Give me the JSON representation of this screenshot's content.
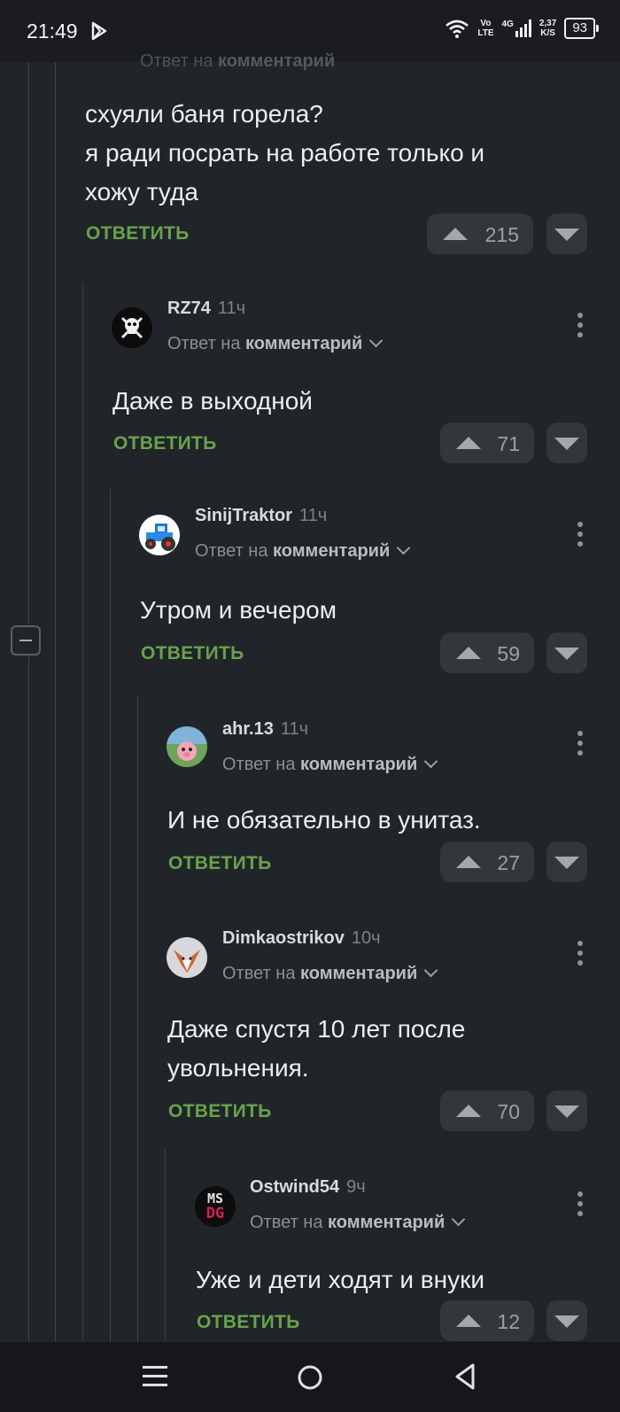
{
  "status_bar": {
    "time": "21:49",
    "net_top": "Vo",
    "net_bottom": "LTE",
    "signal": "4G",
    "speed_top": "2,37",
    "speed_bottom": "K/S",
    "battery": "93",
    "icons": [
      "play-store-icon",
      "wifi-icon",
      "signal-icon",
      "battery-icon"
    ]
  },
  "thread": {
    "cut_header": {
      "prefix": "Ответ на",
      "target": "комментарий"
    },
    "top_comment": {
      "lines": [
        "схуяли баня горела?",
        "я ради посрать на работе только и",
        "хожу туда"
      ],
      "reply_label": "ОТВЕТИТЬ",
      "votes": "215"
    },
    "comments": [
      {
        "author": "RZ74",
        "time": "11ч",
        "reply_prefix": "Ответ на",
        "reply_target": "комментарий",
        "lines": [
          "Даже в выходной"
        ],
        "reply_label": "ОТВЕТИТЬ",
        "votes": "71"
      },
      {
        "author": "SinijTraktor",
        "time": "11ч",
        "reply_prefix": "Ответ на",
        "reply_target": "комментарий",
        "lines": [
          "Утром и вечером"
        ],
        "reply_label": "ОТВЕТИТЬ",
        "votes": "59"
      },
      {
        "author": "ahr.13",
        "time": "11ч",
        "reply_prefix": "Ответ на",
        "reply_target": "комментарий",
        "lines": [
          "И не обязательно в унитаз."
        ],
        "reply_label": "ОТВЕТИТЬ",
        "votes": "27"
      },
      {
        "author": "Dimkaostrikov",
        "time": "10ч",
        "reply_prefix": "Ответ на",
        "reply_target": "комментарий",
        "lines": [
          "Даже спустя 10 лет после",
          "увольнения."
        ],
        "reply_label": "ОТВЕТИТЬ",
        "votes": "70"
      },
      {
        "author": "Ostwind54",
        "time": "9ч",
        "reply_prefix": "Ответ на",
        "reply_target": "комментарий",
        "lines": [
          "Уже и дети ходят и внуки"
        ],
        "reply_label": "ОТВЕТИТЬ",
        "votes": "12"
      }
    ]
  },
  "avatar_text": {
    "ostwind_top": "MS",
    "ostwind_bottom": "DG"
  },
  "colors": {
    "background": "#212428",
    "reply_green": "#67a34c",
    "vote_bg": "#33373c",
    "thread_line": "#3e434a"
  },
  "nav_bar": {
    "icons": [
      "menu-icon",
      "home-icon",
      "back-icon"
    ]
  }
}
